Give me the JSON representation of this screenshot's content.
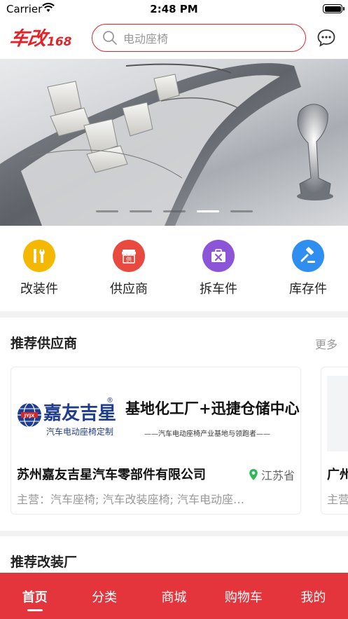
{
  "status_bar": {
    "carrier": "Carrier",
    "time": "2:48 PM"
  },
  "header": {
    "logo_text": "车改",
    "logo_number": "168",
    "search_placeholder": "电动座椅"
  },
  "banner": {
    "slide_count": 5,
    "active_slide": 4
  },
  "categories": [
    {
      "label": "改装件",
      "icon": "wrench-icon",
      "color": "#f5b800"
    },
    {
      "label": "供应商",
      "icon": "store-icon",
      "color": "#e94a3f",
      "glyph": "供"
    },
    {
      "label": "拆车件",
      "icon": "toolbox-icon",
      "color": "#8c54d6"
    },
    {
      "label": "库存件",
      "icon": "gavel-icon",
      "color": "#2f8ef0"
    }
  ],
  "suppliers_section": {
    "title": "推荐供应商",
    "more": "更多",
    "cards": [
      {
        "brand_name": "嘉友吉星",
        "brand_sub": "汽车电动座椅定制",
        "brand_mark": "JYJX",
        "slogan": "基地化工厂+迅捷仓储中心",
        "slogan_sub": "——汽车电动座椅产业基地与领跑者——",
        "name": "苏州嘉友吉星汽车零部件有限公司",
        "location": "江苏省",
        "main_business": "主营：汽车座椅; 汽车改装座椅; 汽车电动座…"
      },
      {
        "name": "广州",
        "main_business": "主营"
      }
    ]
  },
  "shops_section": {
    "title": "推荐改装厂"
  },
  "tabbar": {
    "items": [
      {
        "label": "首页",
        "active": true
      },
      {
        "label": "分类",
        "active": false
      },
      {
        "label": "商城",
        "active": false
      },
      {
        "label": "购物车",
        "active": false
      },
      {
        "label": "我的",
        "active": false
      }
    ]
  },
  "colors": {
    "brand_red": "#e2232a",
    "tabbar_red": "#e3353b"
  }
}
